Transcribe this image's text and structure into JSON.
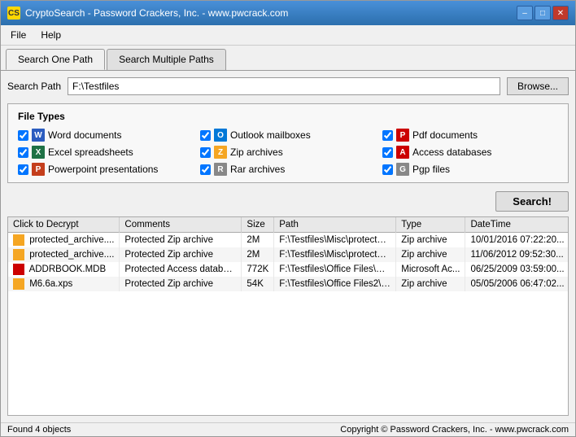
{
  "window": {
    "title": "CryptoSearch - Password Crackers, Inc. - www.pwcrack.com",
    "icon_label": "CS"
  },
  "title_controls": {
    "minimize": "–",
    "maximize": "□",
    "close": "✕"
  },
  "menu": {
    "items": [
      "File",
      "Help"
    ]
  },
  "tabs": [
    {
      "label": "Search One Path",
      "active": true
    },
    {
      "label": "Search Multiple Paths",
      "active": false
    }
  ],
  "search_path": {
    "label": "Search Path",
    "value": "F:\\Testfiles",
    "placeholder": "",
    "browse_label": "Browse..."
  },
  "file_types": {
    "title": "File Types",
    "items": [
      {
        "checked": true,
        "icon_class": "icon-word",
        "icon_text": "W",
        "label": "Word documents",
        "col": 0
      },
      {
        "checked": true,
        "icon_class": "icon-excel",
        "icon_text": "X",
        "label": "Excel spreadsheets",
        "col": 0
      },
      {
        "checked": true,
        "icon_class": "icon-ppt",
        "icon_text": "P",
        "label": "Powerpoint presentations",
        "col": 0
      },
      {
        "checked": true,
        "icon_class": "icon-outlook",
        "icon_text": "O",
        "label": "Outlook mailboxes",
        "col": 1
      },
      {
        "checked": true,
        "icon_class": "icon-zip",
        "icon_text": "Z",
        "label": "Zip archives",
        "col": 1
      },
      {
        "checked": true,
        "icon_class": "icon-rar",
        "icon_text": "R",
        "label": "Rar archives",
        "col": 1
      },
      {
        "checked": true,
        "icon_class": "icon-pdf",
        "icon_text": "P",
        "label": "Pdf documents",
        "col": 2
      },
      {
        "checked": true,
        "icon_class": "icon-access",
        "icon_text": "A",
        "label": "Access databases",
        "col": 2
      },
      {
        "checked": true,
        "icon_class": "icon-pgp",
        "icon_text": "G",
        "label": "Pgp files",
        "col": 2
      }
    ]
  },
  "search_button_label": "Search!",
  "results": {
    "columns": [
      "Click to Decrypt",
      "Comments",
      "Size",
      "Path",
      "Type",
      "DateTime"
    ],
    "rows": [
      {
        "icon_class": "icon-zip-sm",
        "name": "protected_archive....",
        "comments": "Protected Zip archive",
        "size": "2M",
        "path": "F:\\Testfiles\\Misc\\protected_arc...",
        "type": "Zip archive",
        "datetime": "10/01/2016 07:22:20..."
      },
      {
        "icon_class": "icon-zip-sm",
        "name": "protected_archive....",
        "comments": "Protected Zip archive",
        "size": "2M",
        "path": "F:\\Testfiles\\Misc\\protected_arc...",
        "type": "Zip archive",
        "datetime": "11/06/2012 09:52:30..."
      },
      {
        "icon_class": "icon-mdb-sm",
        "name": "ADDRBOOK.MDB",
        "comments": "Protected Access database",
        "size": "772K",
        "path": "F:\\Testfiles\\Office Files\\ADDR...",
        "type": "Microsoft Ac...",
        "datetime": "06/25/2009 03:59:00..."
      },
      {
        "icon_class": "icon-zip-sm",
        "name": "M6.6a.xps",
        "comments": "Protected Zip archive",
        "size": "54K",
        "path": "F:\\Testfiles\\Office Files2\\XPS\\...",
        "type": "Zip archive",
        "datetime": "05/05/2006 06:47:02..."
      }
    ]
  },
  "status": {
    "left": "Found 4 objects",
    "right": "Copyright © Password Crackers, Inc. - www.pwcrack.com"
  }
}
